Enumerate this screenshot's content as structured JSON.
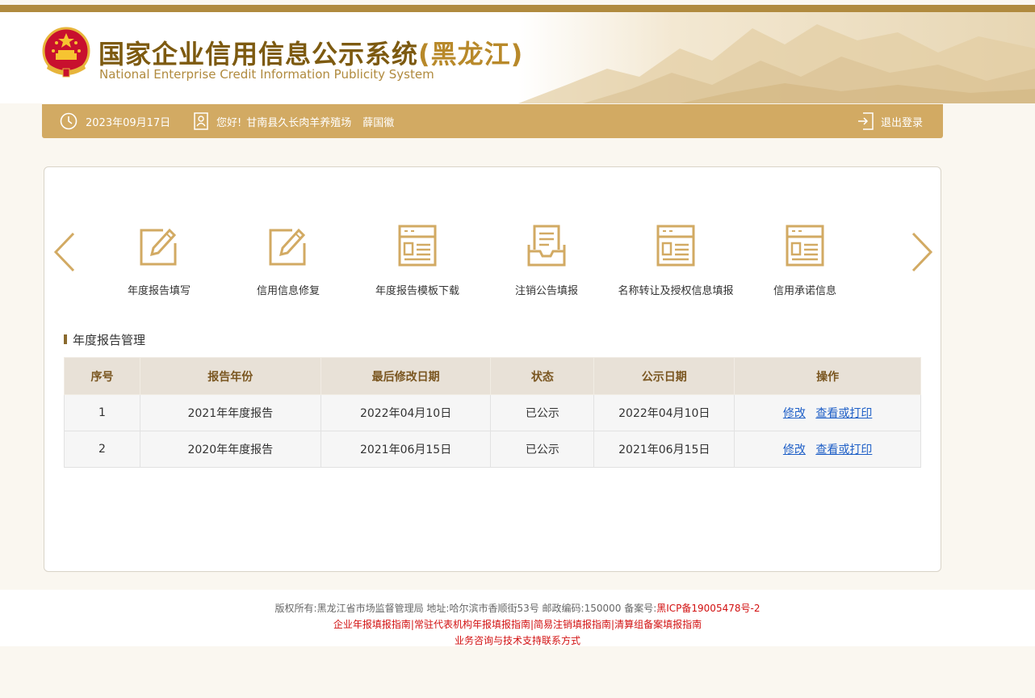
{
  "header": {
    "title_main": "国家企业信用信息公示系统",
    "title_province": "(黑龙江)",
    "title_en": "National Enterprise Credit Information Publicity System"
  },
  "userbar": {
    "date": "2023年09月17日",
    "greeting": "您好!",
    "company": "甘南县久长肉羊养殖场",
    "person": "薛国徽",
    "logout": "退出登录"
  },
  "menu": [
    {
      "label": "年度报告填写",
      "icon": "edit-icon"
    },
    {
      "label": "信用信息修复",
      "icon": "edit-icon"
    },
    {
      "label": "年度报告模板下载",
      "icon": "document-icon"
    },
    {
      "label": "注销公告填报",
      "icon": "inbox-document-icon"
    },
    {
      "label": "名称转让及授权信息填报",
      "icon": "document-icon"
    },
    {
      "label": "信用承诺信息",
      "icon": "document-icon"
    }
  ],
  "section": {
    "title": "年度报告管理"
  },
  "table": {
    "headers": [
      "序号",
      "报告年份",
      "最后修改日期",
      "状态",
      "公示日期",
      "操作"
    ],
    "rows": [
      {
        "no": "1",
        "year": "2021年年度报告",
        "modified": "2022年04月10日",
        "status": "已公示",
        "published": "2022年04月10日",
        "edit": "修改",
        "view": "查看或打印"
      },
      {
        "no": "2",
        "year": "2020年年度报告",
        "modified": "2021年06月15日",
        "status": "已公示",
        "published": "2021年06月15日",
        "edit": "修改",
        "view": "查看或打印"
      }
    ]
  },
  "footer": {
    "line1_prefix": "版权所有:黑龙江省市场监督管理局 地址:哈尔滨市香顺街53号 邮政编码:150000 备案号:",
    "icp": "黑ICP备19005478号-2",
    "links": [
      "企业年报填报指南",
      "常驻代表机构年报填报指南",
      "简易注销填报指南",
      "清算组备案填报指南"
    ],
    "separator": "|",
    "contact": "业务咨询与技术支持联系方式"
  },
  "colors": {
    "brand_gold": "#d2aa63",
    "title_brown": "#7d5a10",
    "link_blue": "#1e5fc7",
    "footer_red": "#d21010"
  }
}
